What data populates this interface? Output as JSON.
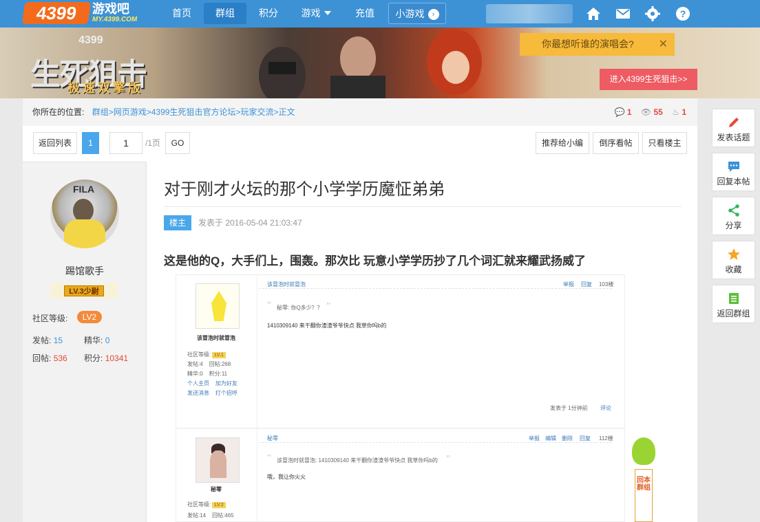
{
  "topnav": {
    "logo": "4399",
    "logo_sub": "游戏吧",
    "logo_domain": "MY.4399.COM",
    "items": [
      {
        "label": "首页"
      },
      {
        "label": "群组"
      },
      {
        "label": "积分"
      },
      {
        "label": "游戏"
      },
      {
        "label": "充值"
      },
      {
        "label": "小游戏"
      }
    ],
    "icons": [
      "home-icon",
      "mail-icon",
      "gear-icon",
      "help-icon"
    ]
  },
  "banner": {
    "game_number": "4399",
    "game_title": "生死狙击",
    "game_subtitle": "极速双擎版",
    "poll": "你最想听谁的演唱会?",
    "enter_button": "进入4399生死狙击>>"
  },
  "breadcrumb": {
    "prefix": "你所在的位置:",
    "items": [
      "群组",
      "网页游戏",
      "4399生死狙击官方论坛",
      "玩家交流",
      "正文"
    ],
    "sep": ">"
  },
  "stats": {
    "comments": "1",
    "views": "55",
    "likes": "1"
  },
  "toolbar": {
    "back_label": "返回列表",
    "current_page": "1",
    "page_input": "1",
    "page_total": "/1页",
    "go_label": "GO",
    "recommend_label": "推荐给小编",
    "reverse_label": "倒序看帖",
    "owner_only_label": "只看楼主"
  },
  "author": {
    "name": "踢馆歌手",
    "rank": "LV.3少尉",
    "level_label": "社区等级:",
    "level": "LV2",
    "posts_label": "发帖:",
    "posts": "15",
    "essence_label": "精华:",
    "essence": "0",
    "replies_label": "回帖:",
    "replies": "536",
    "points_label": "积分:",
    "points": "10341"
  },
  "post": {
    "title": "对于刚才火坛的那个小学学历魔怔弟弟",
    "owner_tag": "楼主",
    "time": "发表于 2016-05-04 21:03:47",
    "body": "这是他的Q，大手们上，围轰。那次比 玩意小学学历抄了几个词汇就来耀武扬威了"
  },
  "embedded": {
    "post1": {
      "header_left": "该冒泡时就冒泡",
      "header_actions": [
        "举报",
        "回复"
      ],
      "floor": "103楼",
      "quote": "秘零: 你Q多少？？",
      "text": "1410309140 来干翻你渣渣爷爷快点 我草你吗b的",
      "footer": "发表于 1分钟前",
      "footer_link": "评论",
      "user": "该冒泡时就冒泡",
      "lv_label": "社区等级:",
      "lv": "LV.1",
      "stats": [
        [
          "发帖:",
          "4",
          "回帖:",
          "268"
        ],
        [
          "精华:",
          "0",
          "积分:",
          "11"
        ]
      ],
      "links": [
        [
          "个人主页",
          "加为好友"
        ],
        [
          "发送消息",
          "打个招呼"
        ]
      ]
    },
    "post2": {
      "header_left": "秘零",
      "header_actions": [
        "举报",
        "编辑",
        "删除",
        "回复"
      ],
      "floor": "112楼",
      "quote": "该冒泡时就冒泡: 1410309140 来干翻你渣渣爷爷快点 我草你吗b的",
      "text": "哦，我让你火火",
      "user": "秘零",
      "lv_label": "社区等级:",
      "lv": "LV.2",
      "stats": [
        [
          "发帖:",
          "14",
          "回帖:",
          "465"
        ]
      ]
    },
    "mascot_tag": "回本群组"
  },
  "float_actions": [
    {
      "label": "发表话题",
      "icon": "pencil-icon",
      "color": "#e4493a"
    },
    {
      "label": "回复本帖",
      "icon": "chat-icon",
      "color": "#3d92d6"
    },
    {
      "label": "分享",
      "icon": "share-icon",
      "color": "#3ab35a"
    },
    {
      "label": "收藏",
      "icon": "star-icon",
      "color": "#f5a623"
    },
    {
      "label": "返回群组",
      "icon": "list-icon",
      "color": "#5bbf3a"
    }
  ]
}
